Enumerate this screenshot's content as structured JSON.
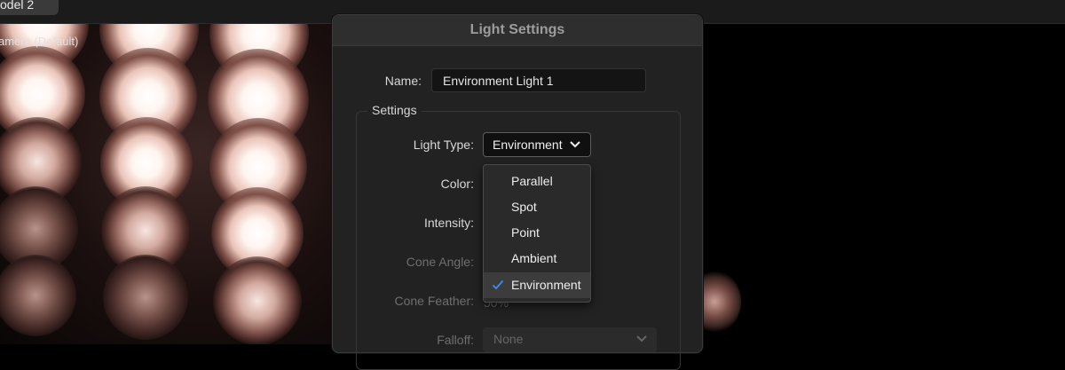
{
  "topbar": {
    "document_tab": "odel 2"
  },
  "viewport": {
    "camera_label": "amera (Default)"
  },
  "dialog": {
    "title": "Light Settings",
    "name_label": "Name:",
    "name_value": "Environment Light 1",
    "settings_group": "Settings",
    "light_type_label": "Light Type:",
    "light_type_value": "Environment",
    "color_label": "Color:",
    "intensity_label": "Intensity:",
    "cone_angle_label": "Cone Angle:",
    "cone_feather_label": "Cone Feather:",
    "cone_feather_value": "50%",
    "falloff_label": "Falloff:",
    "falloff_value": "None"
  },
  "light_type_menu": {
    "options": [
      "Parallel",
      "Spot",
      "Point",
      "Ambient",
      "Environment"
    ],
    "selected": "Environment"
  },
  "colors": {
    "accent_check": "#3b8bf5",
    "dialog_bg": "#222222"
  }
}
